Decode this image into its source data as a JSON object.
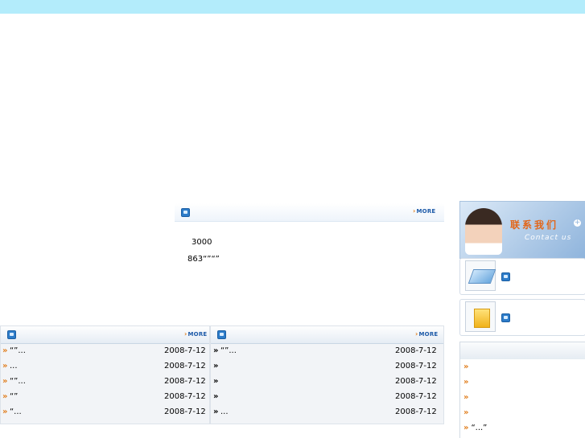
{
  "colors": {
    "topbar": "#b3ecfb",
    "more_link": "#1d5aa8",
    "arrow_orange": "#e07d1c",
    "help_title": "#1d4fb0"
  },
  "intro": {
    "marker": "",
    "title": "",
    "more_label": "MORE",
    "lines": [
      "",
      "3000",
      "863“”“”"
    ]
  },
  "news_left": {
    "marker": "",
    "title": "",
    "more_label": "MORE",
    "items": [
      {
        "title": "“”...",
        "date": "2008-7-12"
      },
      {
        "title": "...",
        "date": "2008-7-12"
      },
      {
        "title": "“”...",
        "date": "2008-7-12"
      },
      {
        "title": "“”",
        "date": "2008-7-12"
      },
      {
        "title": "“...",
        "date": "2008-7-12"
      }
    ]
  },
  "news_right": {
    "title": "",
    "more_label": "MORE",
    "items": [
      {
        "title": "“”...",
        "date": "2008-7-12"
      },
      {
        "title": "",
        "date": "2008-7-12"
      },
      {
        "title": "",
        "date": "2008-7-12"
      },
      {
        "title": "",
        "date": "2008-7-12"
      },
      {
        "title": "...",
        "date": "2008-7-12"
      }
    ]
  },
  "contact": {
    "title_cn": "联系我们",
    "title_en": "Contact us"
  },
  "side_links": [
    {
      "marker": "",
      "label": ""
    },
    {
      "marker": "",
      "label": ""
    }
  ],
  "help": {
    "marker": "",
    "title": "",
    "trailing": "",
    "items": [
      "",
      "",
      "",
      "",
      "“...”"
    ]
  },
  "bottom_marker": ""
}
